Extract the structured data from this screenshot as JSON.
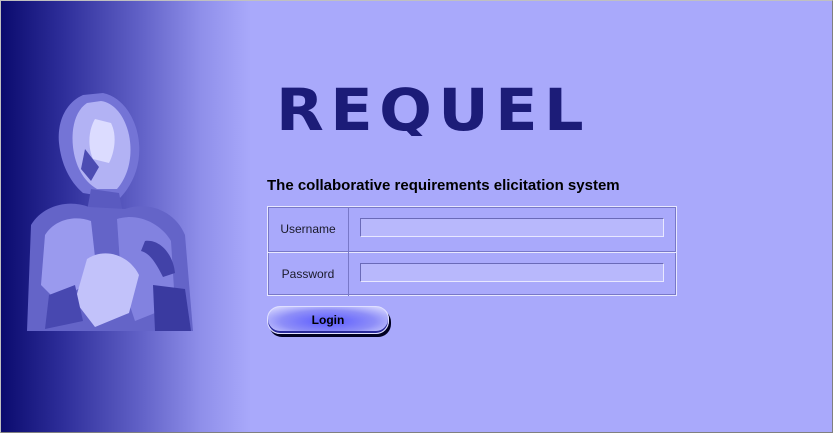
{
  "app": {
    "logo_text": "REQUEL",
    "tagline": "The collaborative requirements elicitation system"
  },
  "form": {
    "username_label": "Username",
    "username_value": "",
    "password_label": "Password",
    "password_value": ""
  },
  "actions": {
    "login_label": "Login"
  },
  "colors": {
    "background": "#a9a9fb",
    "sidebar_dark": "#0b0b6e",
    "logo": "#1c1c78",
    "figure": "#8a8ae0"
  }
}
